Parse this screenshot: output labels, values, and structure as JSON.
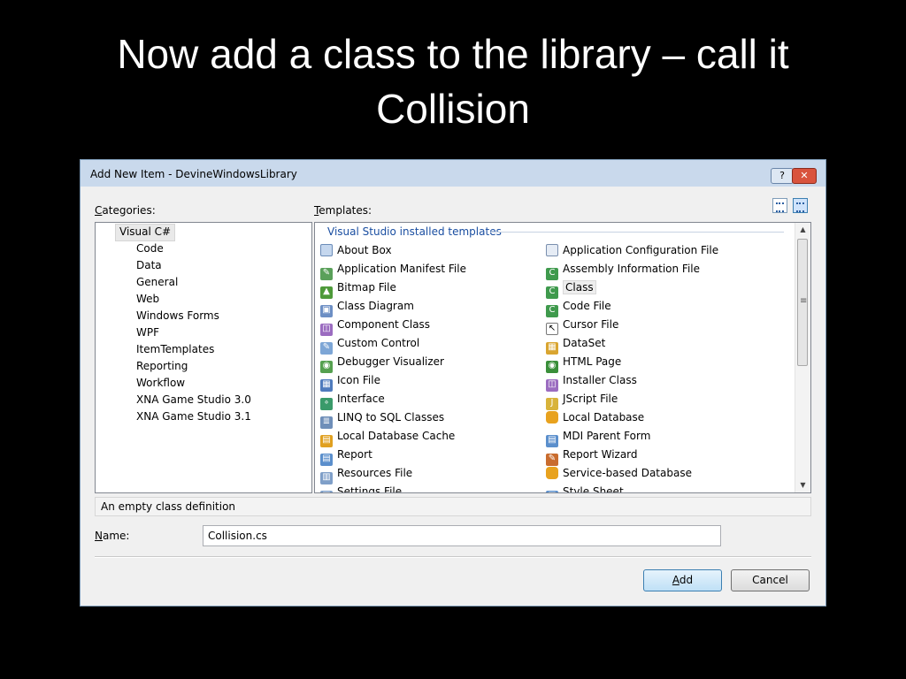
{
  "slide": {
    "title_line1": "Now add a class to the library – call it",
    "title_line2": "Collision"
  },
  "dialog": {
    "title": "Add New Item - DevineWindowsLibrary",
    "help_label": "?",
    "close_label": "✕",
    "categories_label_key": "C",
    "categories_label_rest": "ategories:",
    "templates_label_key": "T",
    "templates_label_rest": "emplates:",
    "categories": [
      "Visual C#",
      "Code",
      "Data",
      "General",
      "Web",
      "Windows Forms",
      "WPF",
      "ItemTemplates",
      "Reporting",
      "Workflow",
      "XNA Game Studio 3.0",
      "XNA Game Studio 3.1"
    ],
    "selected_category": "Visual C#",
    "templates_group": "Visual Studio installed templates",
    "templates_left": [
      {
        "label": "About Box",
        "icon": "form-icon"
      },
      {
        "label": "Application Manifest File",
        "icon": "manifest-icon"
      },
      {
        "label": "Bitmap File",
        "icon": "bitmap-icon"
      },
      {
        "label": "Class Diagram",
        "icon": "class-diagram-icon"
      },
      {
        "label": "Component Class",
        "icon": "component-icon"
      },
      {
        "label": "Custom Control",
        "icon": "custom-control-icon"
      },
      {
        "label": "Debugger Visualizer",
        "icon": "debugger-icon"
      },
      {
        "label": "Icon File",
        "icon": "icon-file-icon"
      },
      {
        "label": "Interface",
        "icon": "interface-icon"
      },
      {
        "label": "LINQ to SQL Classes",
        "icon": "linq-icon"
      },
      {
        "label": "Local Database Cache",
        "icon": "database-cache-icon"
      },
      {
        "label": "Report",
        "icon": "report-icon"
      },
      {
        "label": "Resources File",
        "icon": "resources-icon"
      },
      {
        "label": "Settings File",
        "icon": "settings-icon"
      }
    ],
    "templates_right": [
      {
        "label": "Application Configuration File",
        "icon": "config-file-icon"
      },
      {
        "label": "Assembly Information File",
        "icon": "assembly-icon"
      },
      {
        "label": "Class",
        "icon": "class-icon"
      },
      {
        "label": "Code File",
        "icon": "code-file-icon"
      },
      {
        "label": "Cursor File",
        "icon": "cursor-icon"
      },
      {
        "label": "DataSet",
        "icon": "dataset-icon"
      },
      {
        "label": "HTML Page",
        "icon": "html-icon"
      },
      {
        "label": "Installer Class",
        "icon": "installer-icon"
      },
      {
        "label": "JScript File",
        "icon": "jscript-icon"
      },
      {
        "label": "Local Database",
        "icon": "database-icon"
      },
      {
        "label": "MDI Parent Form",
        "icon": "mdi-form-icon"
      },
      {
        "label": "Report Wizard",
        "icon": "report-wizard-icon"
      },
      {
        "label": "Service-based Database",
        "icon": "service-database-icon"
      },
      {
        "label": "Style Sheet",
        "icon": "stylesheet-icon"
      }
    ],
    "selected_template": "Class",
    "description": "An empty class definition",
    "name_label_key": "N",
    "name_label_rest": "ame:",
    "name_value": "Collision.cs",
    "add_button_key": "A",
    "add_button_rest": "dd",
    "cancel_button": "Cancel"
  },
  "colors": {
    "slide_background": "#000000",
    "dialog_background": "#f0f0f0",
    "group_header": "#1a4ea1",
    "close_button": "#d9533d"
  }
}
